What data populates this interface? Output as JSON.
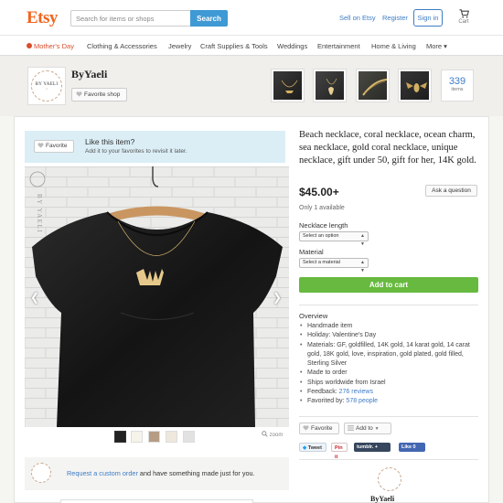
{
  "header": {
    "logo": "Etsy",
    "search_placeholder": "Search for items or shops",
    "search_button": "Search",
    "sell_link": "Sell on Etsy",
    "register_link": "Register",
    "signin_button": "Sign in",
    "cart_label": "Cart",
    "accent_color": "#f1641e",
    "link_color": "#3e7cc4"
  },
  "categories": [
    "Mother's Day",
    "Clothing & Accessories",
    "Jewelry",
    "Craft Supplies & Tools",
    "Weddings",
    "Entertainment",
    "Home & Living",
    "More ▾"
  ],
  "shop": {
    "logo_text": "BY YAELI",
    "name": "ByYaeli",
    "favorite_button": "Favorite shop",
    "items_count": "339",
    "items_label": "items"
  },
  "like_box": {
    "favorite_button": "Favorite",
    "title": "Like this item?",
    "subtitle": "Add it to your favorites to revisit it later."
  },
  "gallery": {
    "zoom_label": "zoom",
    "watermark": "BY YAELI"
  },
  "request": {
    "link_text": "Request a custom order",
    "rest_text": " and have something made just for you."
  },
  "listing": {
    "title": "Beach necklace, coral necklace, ocean charm, sea necklace, gold coral necklace, unique necklace, gift under 50, gift for her, 14K gold.",
    "price": "$45.00+",
    "ask_button": "Ask a question",
    "availability": "Only 1 available",
    "length_label": "Necklace length",
    "length_select": "Select an option",
    "material_label": "Material",
    "material_select": "Select a material",
    "add_to_cart": "Add to cart",
    "overview_title": "Overview",
    "overview": [
      "Handmade item",
      "Holiday: Valentine's Day",
      "Materials: GF, goldfilled, 14K gold, 14 karat gold, 14 carat gold, 18K gold, love, inspiration, gold plated, gold filled, Sterling Silver",
      "Made to order",
      "Ships worldwide from Israel"
    ],
    "feedback_label": "Feedback: ",
    "feedback_link": "276 reviews",
    "favorited_label": "Favorited by: ",
    "favorited_link": "578 people",
    "favorite_button": "Favorite",
    "add_to_button": "Add to",
    "cart_button_color": "#67ba3f"
  },
  "social": {
    "tweet": "Tweet",
    "pin": "Pin it",
    "tumblr": "tumblr. +",
    "like": "Like 0"
  },
  "shop_footer": {
    "name": "ByYaeli"
  }
}
